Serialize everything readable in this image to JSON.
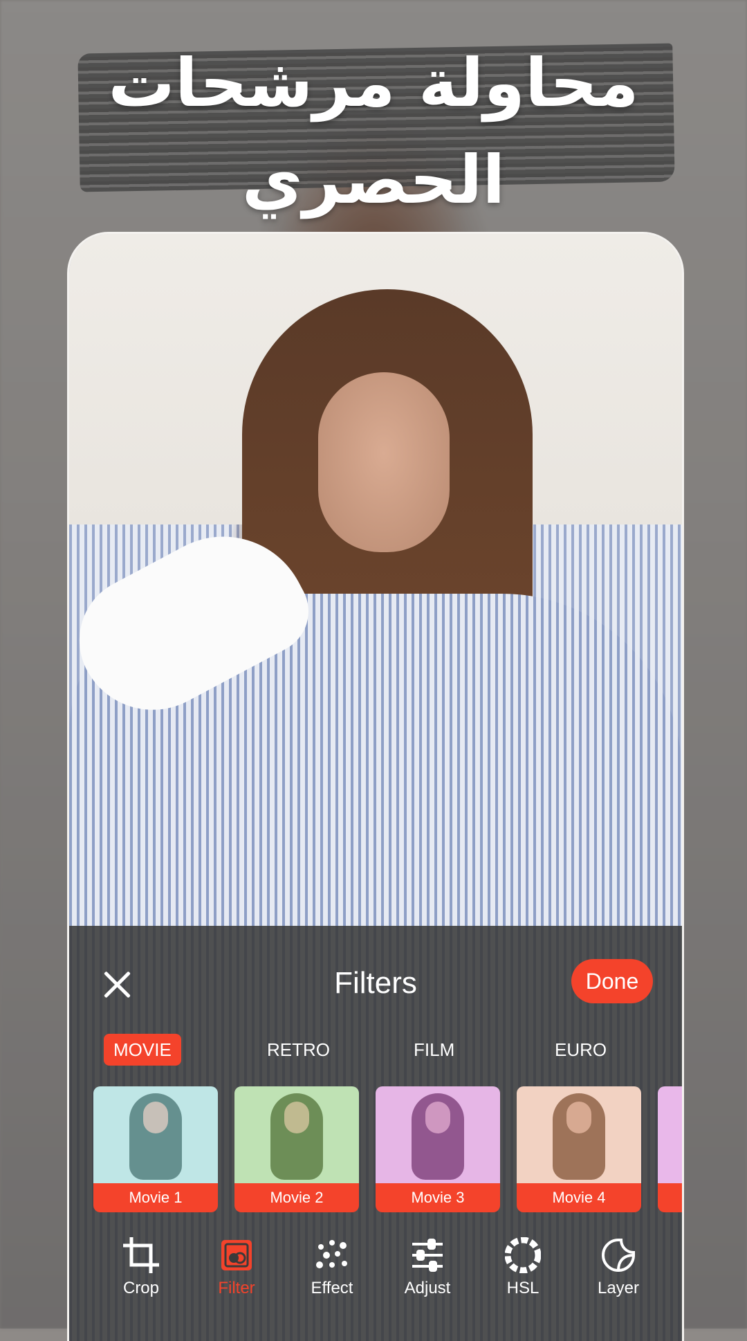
{
  "headline": {
    "line1": "محاولة مرشحات",
    "line2": "الحصري"
  },
  "panel": {
    "title": "Filters",
    "done_label": "Done"
  },
  "tabs": [
    {
      "label": "MOVIE",
      "active": true
    },
    {
      "label": "RETRO",
      "active": false
    },
    {
      "label": "FILM",
      "active": false
    },
    {
      "label": "EURO",
      "active": false
    }
  ],
  "filters": [
    {
      "label": "Movie 1",
      "tint": "#bfe6e6"
    },
    {
      "label": "Movie 2",
      "tint": "#bfe2b4"
    },
    {
      "label": "Movie 3",
      "tint": "#e6b6e6"
    },
    {
      "label": "Movie 4",
      "tint": "#f2d2c2"
    },
    {
      "label": "",
      "tint": "#e9b8ea"
    }
  ],
  "tools": [
    {
      "label": "Crop",
      "icon": "crop-icon",
      "active": false
    },
    {
      "label": "Filter",
      "icon": "filter-icon",
      "active": true
    },
    {
      "label": "Effect",
      "icon": "effect-icon",
      "active": false
    },
    {
      "label": "Adjust",
      "icon": "adjust-icon",
      "active": false
    },
    {
      "label": "HSL",
      "icon": "hsl-icon",
      "active": false
    },
    {
      "label": "Layer",
      "icon": "layer-icon",
      "active": false
    }
  ],
  "colors": {
    "accent": "#f4432b",
    "panel_bg": "#3a3a3a"
  }
}
